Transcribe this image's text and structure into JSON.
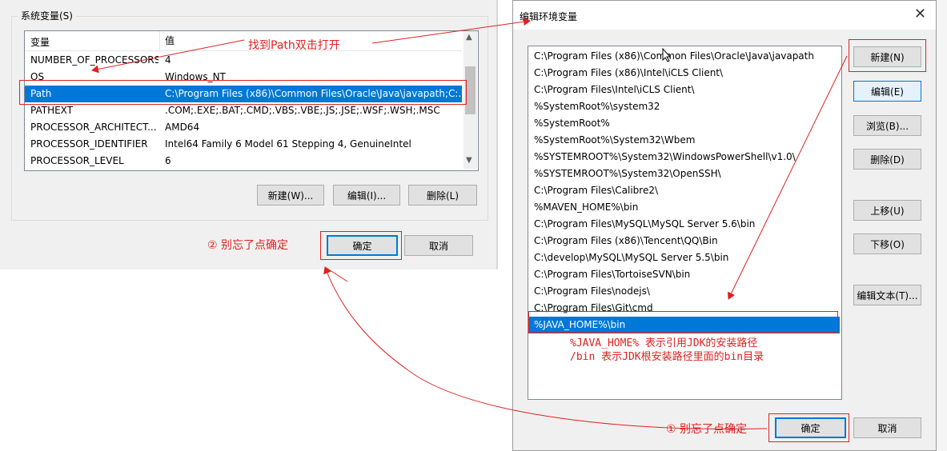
{
  "left_panel": {
    "group_label": "系统变量(S)",
    "columns": {
      "name": "变量",
      "value": "值"
    },
    "rows": [
      {
        "name": "NUMBER_OF_PROCESSORS",
        "value": "4"
      },
      {
        "name": "OS",
        "value": "Windows_NT"
      },
      {
        "name": "Path",
        "value": "C:\\Program Files (x86)\\Common Files\\Oracle\\Java\\javapath;C:..."
      },
      {
        "name": "PATHEXT",
        "value": ".COM;.EXE;.BAT;.CMD;.VBS;.VBE;.JS;.JSE;.WSF;.WSH;.MSC"
      },
      {
        "name": "PROCESSOR_ARCHITECT...",
        "value": "AMD64"
      },
      {
        "name": "PROCESSOR_IDENTIFIER",
        "value": "Intel64 Family 6 Model 61 Stepping 4, GenuineIntel"
      },
      {
        "name": "PROCESSOR_LEVEL",
        "value": "6"
      }
    ],
    "selected_row": "Path",
    "buttons": {
      "new": "新建(W)...",
      "edit": "编辑(I)...",
      "delete": "删除(L)"
    },
    "ok": "确定",
    "cancel": "取消"
  },
  "dialog": {
    "title": "编辑环境变量",
    "paths": [
      "C:\\Program Files (x86)\\Common Files\\Oracle\\Java\\javapath",
      "C:\\Program Files (x86)\\Intel\\iCLS Client\\",
      "C:\\Program Files\\Intel\\iCLS Client\\",
      "%SystemRoot%\\system32",
      "%SystemRoot%",
      "%SystemRoot%\\System32\\Wbem",
      "%SYSTEMROOT%\\System32\\WindowsPowerShell\\v1.0\\",
      "%SYSTEMROOT%\\System32\\OpenSSH\\",
      "C:\\Program Files\\Calibre2\\",
      "%MAVEN_HOME%\\bin",
      "C:\\Program Files\\MySQL\\MySQL Server 5.6\\bin",
      "C:\\Program Files (x86)\\Tencent\\QQ\\Bin",
      "C:\\develop\\MySQL\\MySQL Server 5.5\\bin",
      "C:\\Program Files\\TortoiseSVN\\bin",
      "C:\\Program Files\\nodejs\\",
      "C:\\Program Files\\Git\\cmd",
      "%JAVA_HOME%\\bin"
    ],
    "selected_path": "%JAVA_HOME%\\bin",
    "buttons": {
      "new": "新建(N)",
      "edit": "编辑(E)",
      "browse": "浏览(B)...",
      "delete": "删除(D)",
      "move_up": "上移(U)",
      "move_down": "下移(O)",
      "edit_text": "编辑文本(T)..."
    },
    "ok": "确定",
    "cancel": "取消"
  },
  "annotations": {
    "find_path": "找到Path双击打开",
    "remember_ok_left": "② 别忘了点确定",
    "remember_ok_right": "① 别忘了点确定",
    "java_home_note_1": "%JAVA_HOME% 表示引用JDK的安装路径",
    "java_home_note_2": "/bin 表示JDK根安装路径里面的bin目录"
  },
  "colors": {
    "selection": "#0078d7",
    "annotation": "#e02020",
    "panel_bg": "#f0f0f0"
  }
}
